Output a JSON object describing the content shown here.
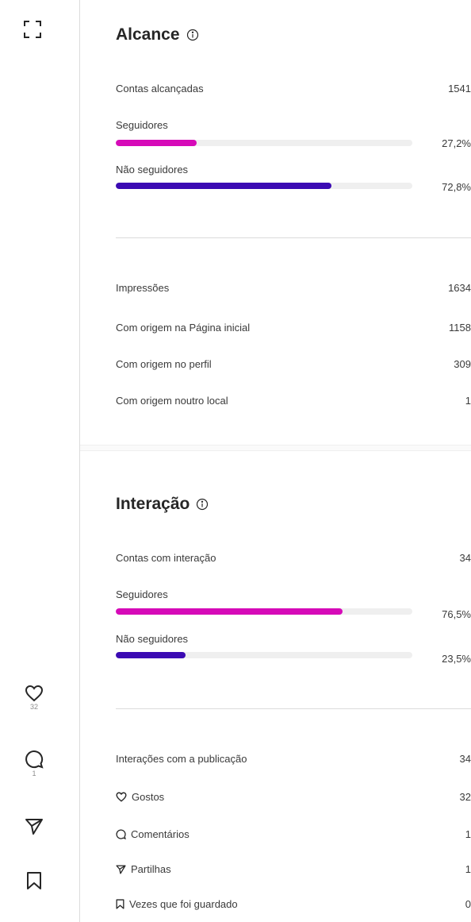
{
  "colors": {
    "followers": "#d60ab8",
    "non_followers": "#3b0ab3"
  },
  "rail": {
    "likes_count": "32",
    "comments_count": "1",
    "icons": [
      "expand-icon",
      "heart-icon",
      "comment-icon",
      "send-icon",
      "bookmark-icon"
    ]
  },
  "reach": {
    "title": "Alcance",
    "accounts_label": "Contas alcançadas",
    "accounts_value": "1541",
    "followers_label": "Seguidores",
    "followers_pct": "27,2%",
    "followers_fraction": 0.272,
    "non_followers_label": "Não seguidores",
    "non_followers_pct": "72,8%",
    "non_followers_fraction": 0.728
  },
  "impressions": {
    "total_label": "Impressões",
    "total_value": "1634",
    "home_label": "Com origem na Página inicial",
    "home_value": "1158",
    "profile_label": "Com origem no perfil",
    "profile_value": "309",
    "other_label": "Com origem noutro local",
    "other_value": "1"
  },
  "interaction": {
    "title": "Interação",
    "accounts_label": "Contas com interação",
    "accounts_value": "34",
    "followers_label": "Seguidores",
    "followers_pct": "76,5%",
    "followers_fraction": 0.765,
    "non_followers_label": "Não seguidores",
    "non_followers_pct": "23,5%",
    "non_followers_fraction": 0.235
  },
  "post_interactions": {
    "total_label": "Interações com a publicação",
    "total_value": "34",
    "likes_label": "Gostos",
    "likes_value": "32",
    "comments_label": "Comentários",
    "comments_value": "1",
    "shares_label": "Partilhas",
    "shares_value": "1",
    "saves_label": "Vezes que foi guardado",
    "saves_value": "0"
  }
}
